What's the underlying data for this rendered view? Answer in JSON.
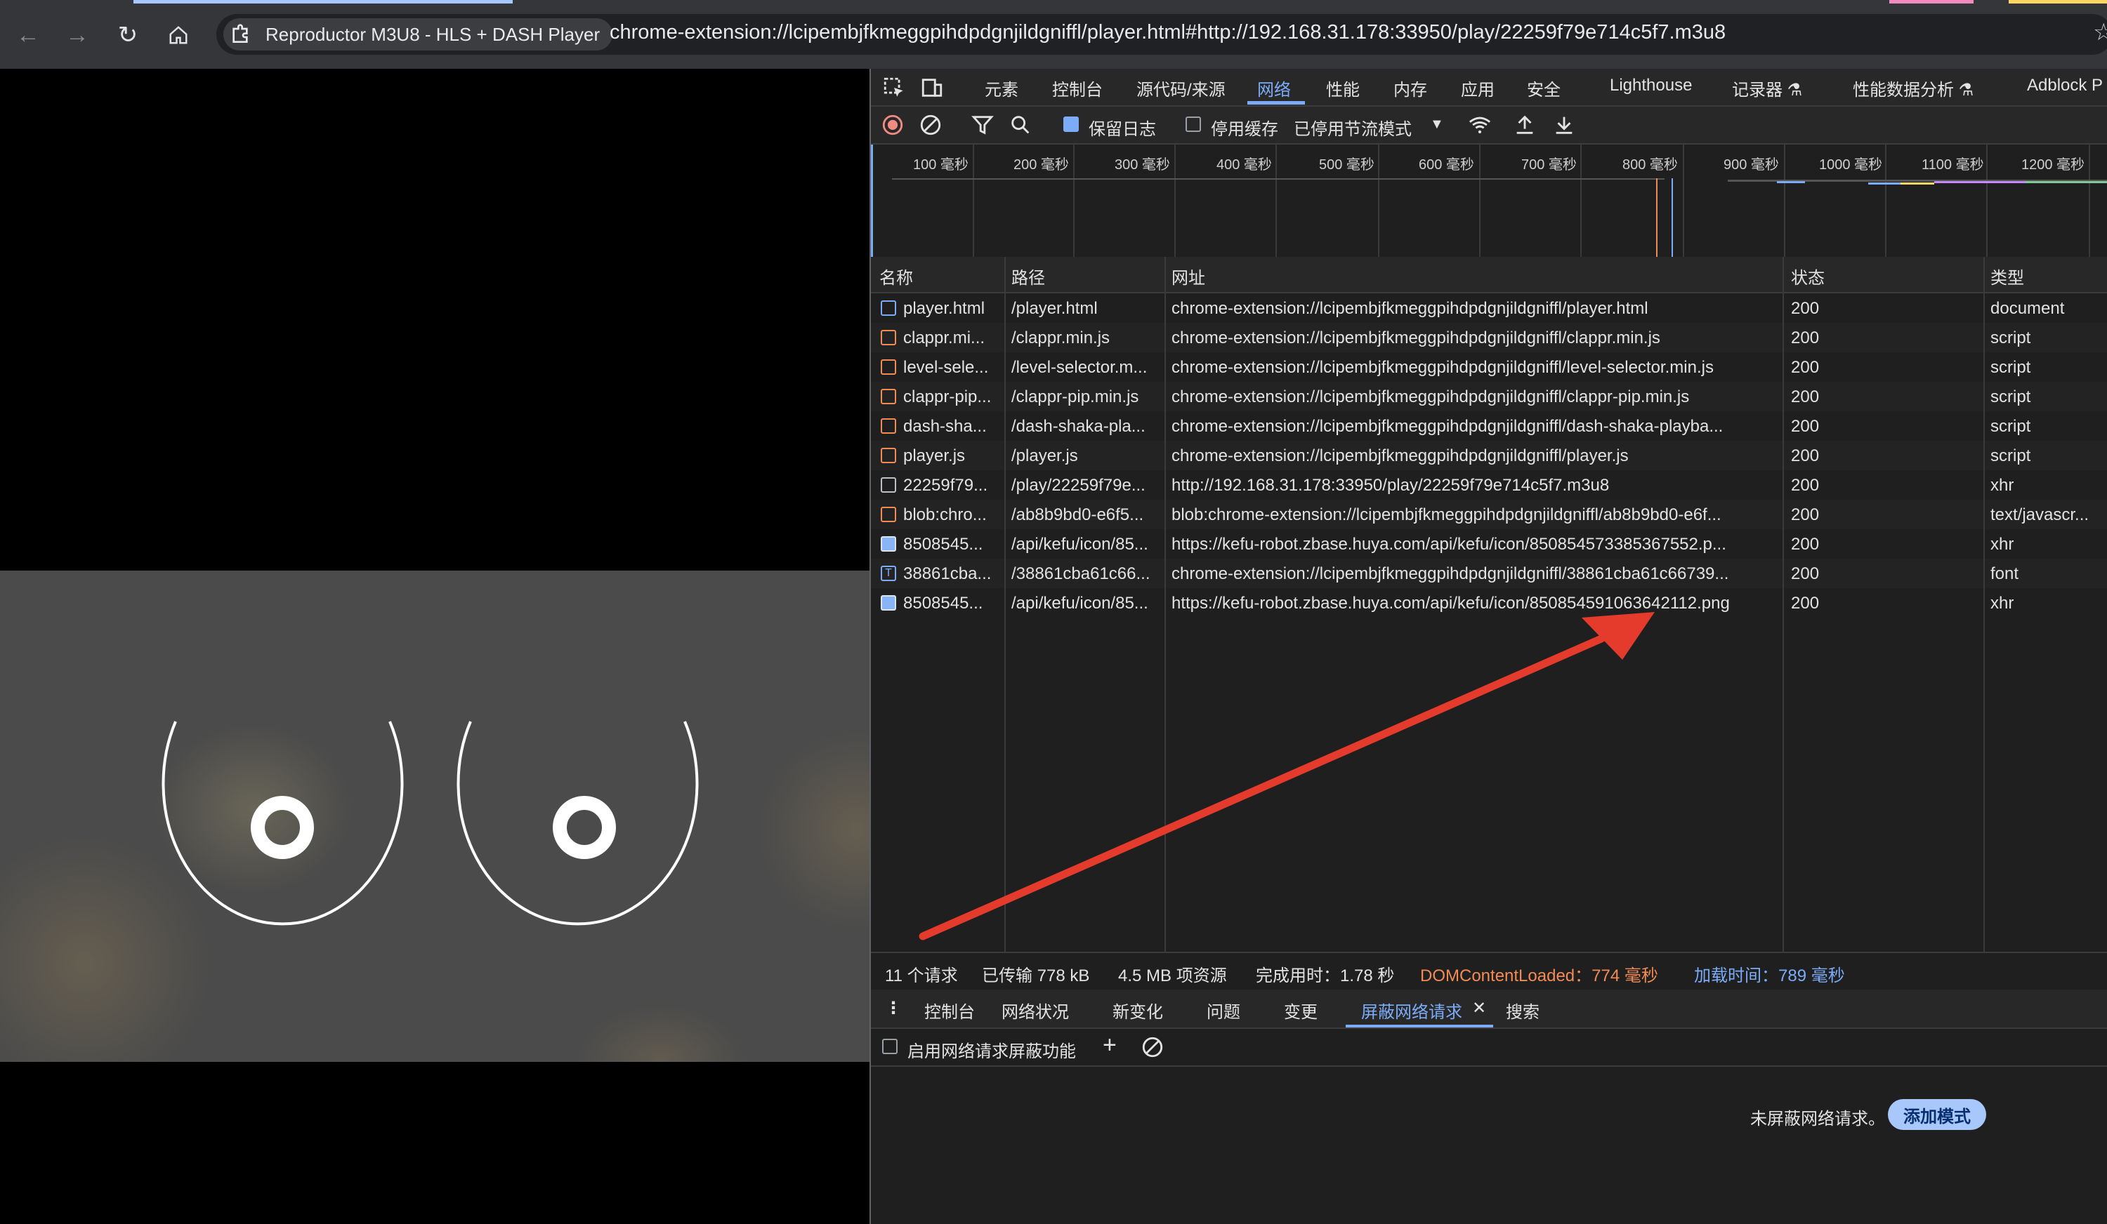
{
  "browser": {
    "tab_title": "Reproductor M3U8 - HLS + DASH Player",
    "url": "chrome-extension://lcipembjfkmeggpihdpdgnjildgniffl/player.html#http://192.168.31.178:33950/play/22259f79e714c5f7.m3u8"
  },
  "devtools": {
    "tabs": [
      "元素",
      "控制台",
      "源代码/来源",
      "网络",
      "性能",
      "内存",
      "应用",
      "安全",
      "Lighthouse",
      "记录器",
      "性能数据分析",
      "Adblock P"
    ],
    "active_tab": "网络",
    "toolbar": {
      "preserve_log": "保留日志",
      "disable_cache": "停用缓存",
      "throttling": "已停用节流模式"
    },
    "timeline_ticks": [
      "100 毫秒",
      "200 毫秒",
      "300 毫秒",
      "400 毫秒",
      "500 毫秒",
      "600 毫秒",
      "700 毫秒",
      "800 毫秒",
      "900 毫秒",
      "1000 毫秒",
      "1100 毫秒",
      "1200 毫秒"
    ],
    "columns": {
      "name": "名称",
      "path": "路径",
      "url": "网址",
      "status": "状态",
      "type": "类型"
    },
    "rows": [
      {
        "name": "player.html",
        "path": "/player.html",
        "url": "chrome-extension://lcipembjfkmeggpihdpdgnjildgniffl/player.html",
        "status": "200",
        "type": "document",
        "icon": "document-icon"
      },
      {
        "name": "clappr.mi...",
        "path": "/clappr.min.js",
        "url": "chrome-extension://lcipembjfkmeggpihdpdgnjildgniffl/clappr.min.js",
        "status": "200",
        "type": "script",
        "icon": "script-icon"
      },
      {
        "name": "level-sele...",
        "path": "/level-selector.m...",
        "url": "chrome-extension://lcipembjfkmeggpihdpdgnjildgniffl/level-selector.min.js",
        "status": "200",
        "type": "script",
        "icon": "script-icon"
      },
      {
        "name": "clappr-pip...",
        "path": "/clappr-pip.min.js",
        "url": "chrome-extension://lcipembjfkmeggpihdpdgnjildgniffl/clappr-pip.min.js",
        "status": "200",
        "type": "script",
        "icon": "script-icon"
      },
      {
        "name": "dash-sha...",
        "path": "/dash-shaka-pla...",
        "url": "chrome-extension://lcipembjfkmeggpihdpdgnjildgniffl/dash-shaka-playba...",
        "status": "200",
        "type": "script",
        "icon": "script-icon"
      },
      {
        "name": "player.js",
        "path": "/player.js",
        "url": "chrome-extension://lcipembjfkmeggpihdpdgnjildgniffl/player.js",
        "status": "200",
        "type": "script",
        "icon": "script-icon"
      },
      {
        "name": "22259f79...",
        "path": "/play/22259f79e...",
        "url": "http://192.168.31.178:33950/play/22259f79e714c5f7.m3u8",
        "status": "200",
        "type": "xhr",
        "icon": "file-icon"
      },
      {
        "name": "blob:chro...",
        "path": "/ab8b9bd0-e6f5...",
        "url": "blob:chrome-extension://lcipembjfkmeggpihdpdgnjildgniffl/ab8b9bd0-e6f...",
        "status": "200",
        "type": "text/javascr...",
        "icon": "script-icon"
      },
      {
        "name": "8508545...",
        "path": "/api/kefu/icon/85...",
        "url": "https://kefu-robot.zbase.huya.com/api/kefu/icon/850854573385367552.p...",
        "status": "200",
        "type": "xhr",
        "icon": "image-icon"
      },
      {
        "name": "38861cba...",
        "path": "/38861cba61c66...",
        "url": "chrome-extension://lcipembjfkmeggpihdpdgnjildgniffl/38861cba61c66739...",
        "status": "200",
        "type": "font",
        "icon": "font-icon"
      },
      {
        "name": "8508545...",
        "path": "/api/kefu/icon/85...",
        "url": "https://kefu-robot.zbase.huya.com/api/kefu/icon/850854591063642112.png",
        "status": "200",
        "type": "xhr",
        "icon": "image-icon"
      }
    ],
    "status_bar": {
      "requests": "11 个请求",
      "transferred": "已传输 778 kB",
      "resources": "4.5 MB 项资源",
      "finish": "完成用时：1.78 秒",
      "dom_loaded": "DOMContentLoaded：774 毫秒",
      "load": "加载时间：789 毫秒"
    },
    "drawer_tabs": [
      "控制台",
      "网络状况",
      "新变化",
      "问题",
      "变更",
      "屏蔽网络请求",
      "搜索"
    ],
    "drawer_active": "屏蔽网络请求",
    "drawer": {
      "enable_blocking": "启用网络请求屏蔽功能",
      "empty_text": "未屏蔽网络请求。",
      "add_pattern": "添加模式"
    }
  },
  "colors": {
    "accent": "#7cacf8",
    "dom_loaded": "#f28b54",
    "load": "#7cacf8",
    "arrow": "#e43b2c"
  }
}
